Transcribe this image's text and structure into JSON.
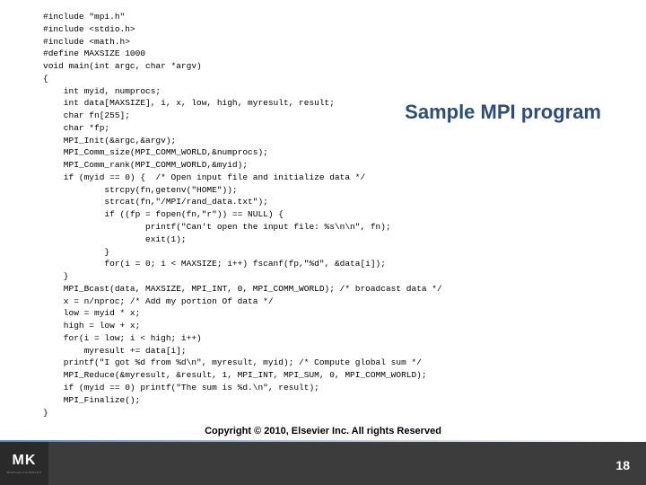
{
  "title": "Sample MPI program",
  "code": "#include \"mpi.h\"\n#include <stdio.h>\n#include <math.h>\n#define MAXSIZE 1000\nvoid main(int argc, char *argv)\n{\n    int myid, numprocs;\n    int data[MAXSIZE], i, x, low, high, myresult, result;\n    char fn[255];\n    char *fp;\n    MPI_Init(&argc,&argv);\n    MPI_Comm_size(MPI_COMM_WORLD,&numprocs);\n    MPI_Comm_rank(MPI_COMM_WORLD,&myid);\n    if (myid == 0) {  /* Open input file and initialize data */\n            strcpy(fn,getenv(\"HOME\"));\n            strcat(fn,\"/MPI/rand_data.txt\");\n            if ((fp = fopen(fn,\"r\")) == NULL) {\n                    printf(\"Can't open the input file: %s\\n\\n\", fn);\n                    exit(1);\n            }\n            for(i = 0; i < MAXSIZE; i++) fscanf(fp,\"%d\", &data[i]);\n    }\n    MPI_Bcast(data, MAXSIZE, MPI_INT, 0, MPI_COMM_WORLD); /* broadcast data */\n    x = n/nproc; /* Add my portion Of data */\n    low = myid * x;\n    high = low + x;\n    for(i = low; i < high; i++)\n        myresult += data[i];\n    printf(\"I got %d from %d\\n\", myresult, myid); /* Compute global sum */\n    MPI_Reduce(&myresult, &result, 1, MPI_INT, MPI_SUM, 0, MPI_COMM_WORLD);\n    if (myid == 0) printf(\"The sum is %d.\\n\", result);\n    MPI_Finalize();\n}",
  "copyright": "Copyright © 2010, Elsevier Inc. All rights Reserved",
  "page_number": "18",
  "logo": {
    "brand": "MK",
    "subtext": "MORGAN KAUFMANN"
  }
}
